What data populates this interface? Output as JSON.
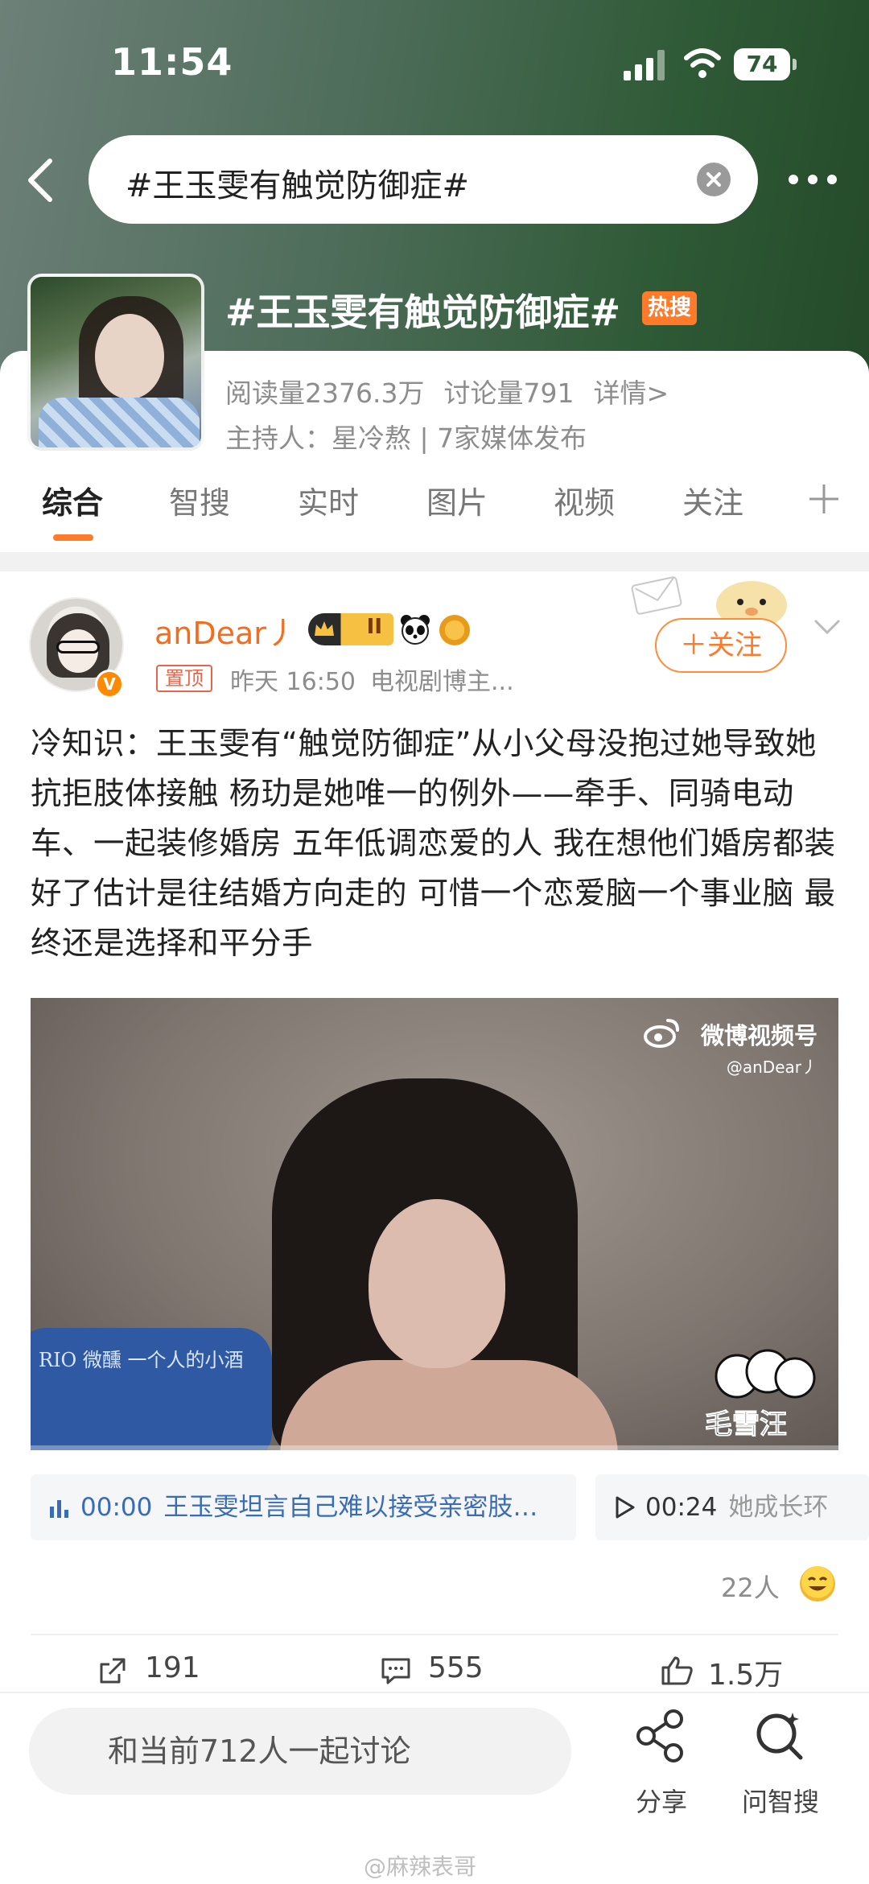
{
  "status_bar": {
    "time": "11:54",
    "battery": "74"
  },
  "search": {
    "query": "#王玉雯有触觉防御症#"
  },
  "topic": {
    "title": "#王玉雯有触觉防御症#",
    "hot_badge": "热搜",
    "reads": "阅读量2376.3万",
    "discussions": "讨论量791",
    "details_link": "详情>",
    "host_line": "主持人：星冷熬 | 7家媒体发布"
  },
  "tabs": [
    {
      "label": "综合",
      "active": true
    },
    {
      "label": "智搜"
    },
    {
      "label": "实时"
    },
    {
      "label": "图片"
    },
    {
      "label": "视频"
    },
    {
      "label": "关注"
    }
  ],
  "post": {
    "username": "anDear丿",
    "level_badge": "II",
    "pinned": "置顶",
    "time": "昨天 16:50",
    "source": "电视剧博主...",
    "follow_label": "＋关注",
    "text": "冷知识：王玉雯有“触觉防御症”从小父母没抱过她导致她抗拒肢体接触  杨玏是她唯一的例外——牵手、同骑电动车、一起装修婚房 五年低调恋爱的人 我在想他们婚房都装好了估计是往结婚方向走的 可惜一个恋爱脑一个事业脑 最终还是选择和平分手",
    "video": {
      "watermark_brand": "微博视频号",
      "watermark_user": "@anDear丿",
      "sticker_text": "毛雪汪",
      "cushion_text": "RIO 微醺 一个人的小酒"
    },
    "chapters": [
      {
        "time": "00:00",
        "title": "王玉雯坦言自己难以接受亲密肢…",
        "active": true
      },
      {
        "time": "00:24",
        "title": "她成长环"
      }
    ],
    "viewers": "22人",
    "shares": "191",
    "comments": "555",
    "likes": "1.5万"
  },
  "bottom_bar": {
    "discuss_placeholder": "和当前712人一起讨论",
    "share_label": "分享",
    "ai_search_label": "问智搜"
  },
  "footer_watermark": "@麻辣表哥",
  "colors": {
    "accent": "#ff7a2a",
    "link": "#3a6cb5",
    "header_green": "#2f5a36"
  }
}
